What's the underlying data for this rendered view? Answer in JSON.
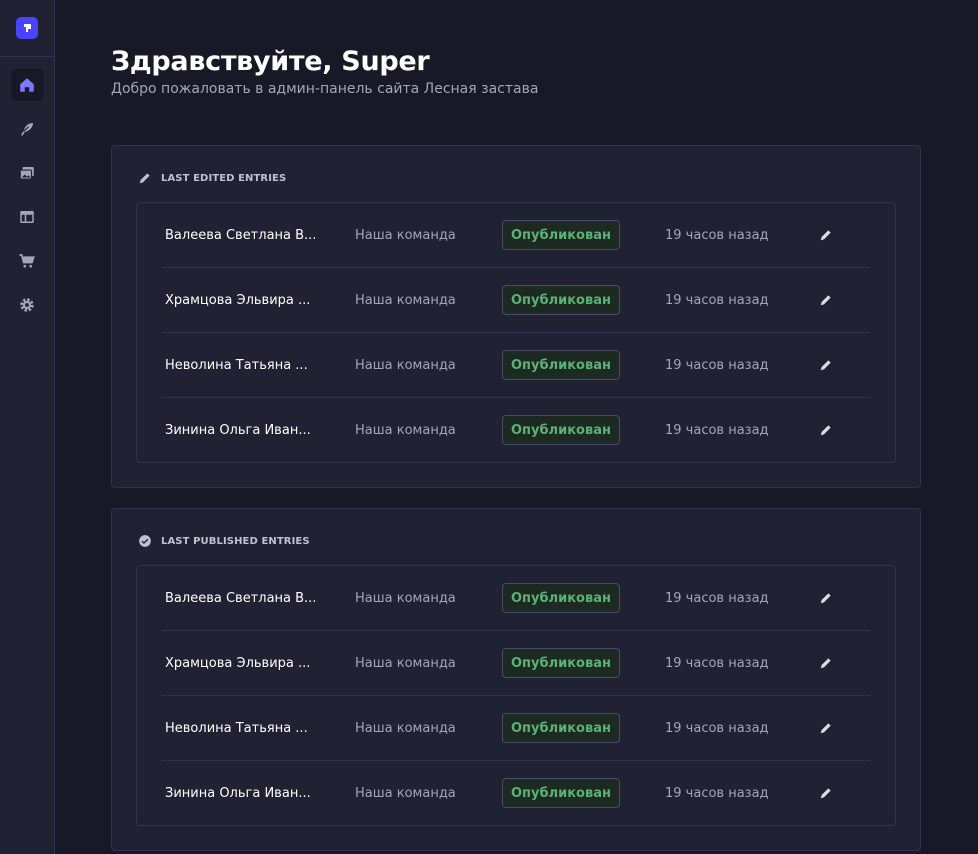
{
  "header": {
    "title": "Здравствуйте, Super",
    "subtitle": "Добро пожаловать в админ-панель сайта Лесная застава"
  },
  "sidebar": {
    "items": [
      {
        "icon": "home-icon",
        "active": true
      },
      {
        "icon": "feather-icon",
        "active": false
      },
      {
        "icon": "media-library-icon",
        "active": false
      },
      {
        "icon": "layout-icon",
        "active": false
      },
      {
        "icon": "cart-icon",
        "active": false
      },
      {
        "icon": "gear-icon",
        "active": false
      }
    ]
  },
  "colors": {
    "accent": "#4945ff",
    "published": "#5cb176",
    "background": "#181826",
    "panel": "#212134"
  },
  "last_edited": {
    "heading": "LAST EDITED ENTRIES",
    "icon": "pencil-icon",
    "rows": [
      {
        "name": "Валеева Светлана В...",
        "type": "Наша команда",
        "status": "Опубликован",
        "time": "19 часов назад"
      },
      {
        "name": "Храмцова Эльвира ...",
        "type": "Наша команда",
        "status": "Опубликован",
        "time": "19 часов назад"
      },
      {
        "name": "Неволина Татьяна ...",
        "type": "Наша команда",
        "status": "Опубликован",
        "time": "19 часов назад"
      },
      {
        "name": "Зинина Ольга Иван...",
        "type": "Наша команда",
        "status": "Опубликован",
        "time": "19 часов назад"
      }
    ]
  },
  "last_published": {
    "heading": "LAST PUBLISHED ENTRIES",
    "icon": "check-circle-icon",
    "rows": [
      {
        "name": "Валеева Светлана В...",
        "type": "Наша команда",
        "status": "Опубликован",
        "time": "19 часов назад"
      },
      {
        "name": "Храмцова Эльвира ...",
        "type": "Наша команда",
        "status": "Опубликован",
        "time": "19 часов назад"
      },
      {
        "name": "Неволина Татьяна ...",
        "type": "Наша команда",
        "status": "Опубликован",
        "time": "19 часов назад"
      },
      {
        "name": "Зинина Ольга Иван...",
        "type": "Наша команда",
        "status": "Опубликован",
        "time": "19 часов назад"
      }
    ]
  }
}
